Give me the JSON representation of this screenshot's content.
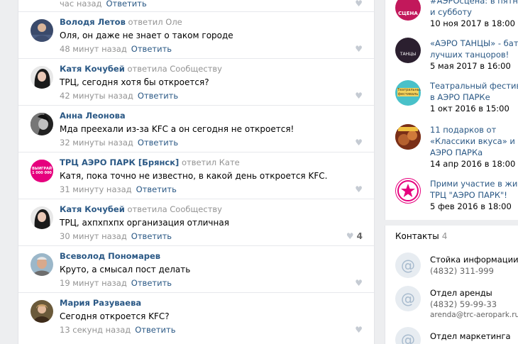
{
  "feed": {
    "partial_top": {
      "time": "час назад",
      "reply": "Ответить"
    },
    "comments": [
      {
        "author": "Володя Летов",
        "replied_to": "ответил Оле",
        "text": "Оля, он даже не знает о таком городе",
        "time": "48 минут назад",
        "reply": "Ответить",
        "likes": ""
      },
      {
        "author": "Катя Кочубей",
        "replied_to": "ответила Сообществу",
        "text": "ТРЦ, сегодня хотя бы откроется?",
        "time": "42 минуты назад",
        "reply": "Ответить",
        "likes": ""
      },
      {
        "author": "Анна Леонова",
        "replied_to": "",
        "text": "Мда преехали из-за KFC а он сегодня не откроется!",
        "time": "32 минуты назад",
        "reply": "Ответить",
        "likes": ""
      },
      {
        "author": "ТРЦ АЭРО ПАРК [Брянск]",
        "replied_to": "ответил Кате",
        "text": "Катя, пока точно не известно, в какой день откроется KFC.",
        "time": "31 минуту назад",
        "reply": "Ответить",
        "likes": "",
        "avatar_text": "ВЫИГРАЙ 1 000 000"
      },
      {
        "author": "Катя Кочубей",
        "replied_to": "ответила Сообществу",
        "text": "ТРЦ, ахпхпхпх организация отличная",
        "time": "30 минут назад",
        "reply": "Ответить",
        "likes": "4"
      },
      {
        "author": "Всеволод Пономарев",
        "replied_to": "",
        "text": "Круто, а смысал пост делать",
        "time": "19 минут назад",
        "reply": "Ответить",
        "likes": ""
      },
      {
        "author": "Мария Разуваева",
        "replied_to": "",
        "text": "Сегодня откроется KFC?",
        "time": "13 секунд назад",
        "reply": "Ответить",
        "likes": ""
      }
    ]
  },
  "events": [
    {
      "title_lines": [
        "#АЭРОсцена: в пятницу",
        "и субботу"
      ],
      "date": "10 ноя 2017 в 18:00",
      "pic_text": "СЦЕНА"
    },
    {
      "title_lines": [
        "«АЭРО ТАНЦЫ» - баттл",
        "лучших танцоров!"
      ],
      "date": "5 мая 2017 в 16:00",
      "pic_text": "ТАНЦЫ"
    },
    {
      "title_lines": [
        "Театральный фестиваль",
        "в АЭРО ПАРКе"
      ],
      "date": "1 окт 2016 в 15:00",
      "pic_text": "Театральный фестиваль"
    },
    {
      "title_lines": [
        "11 подарков от",
        "«Классики вкуса» и",
        "АЭРО ПАРКа"
      ],
      "date": "14 апр 2016 в 18:00",
      "pic_text": ""
    },
    {
      "title_lines": [
        "Прими участие в жизни",
        "ТРЦ \"АЭРО ПАРК\"!"
      ],
      "date": "5 фев 2016 в 18:00",
      "pic_text": ""
    }
  ],
  "contacts": {
    "title": "Контакты",
    "count": "4",
    "items": [
      {
        "name": "Стойка информации",
        "details": [
          "(4832) 311-999"
        ]
      },
      {
        "name": "Отдел аренды",
        "details": [
          "(4832) 59-99-33",
          "arenda@trc-aeropark.ru"
        ]
      },
      {
        "name": "Отдел маркетинга",
        "details": []
      }
    ]
  },
  "colors": {
    "link": "#2a5885",
    "muted": "#939393",
    "background": "#edeef0",
    "brand_pink": "#e6007e"
  }
}
